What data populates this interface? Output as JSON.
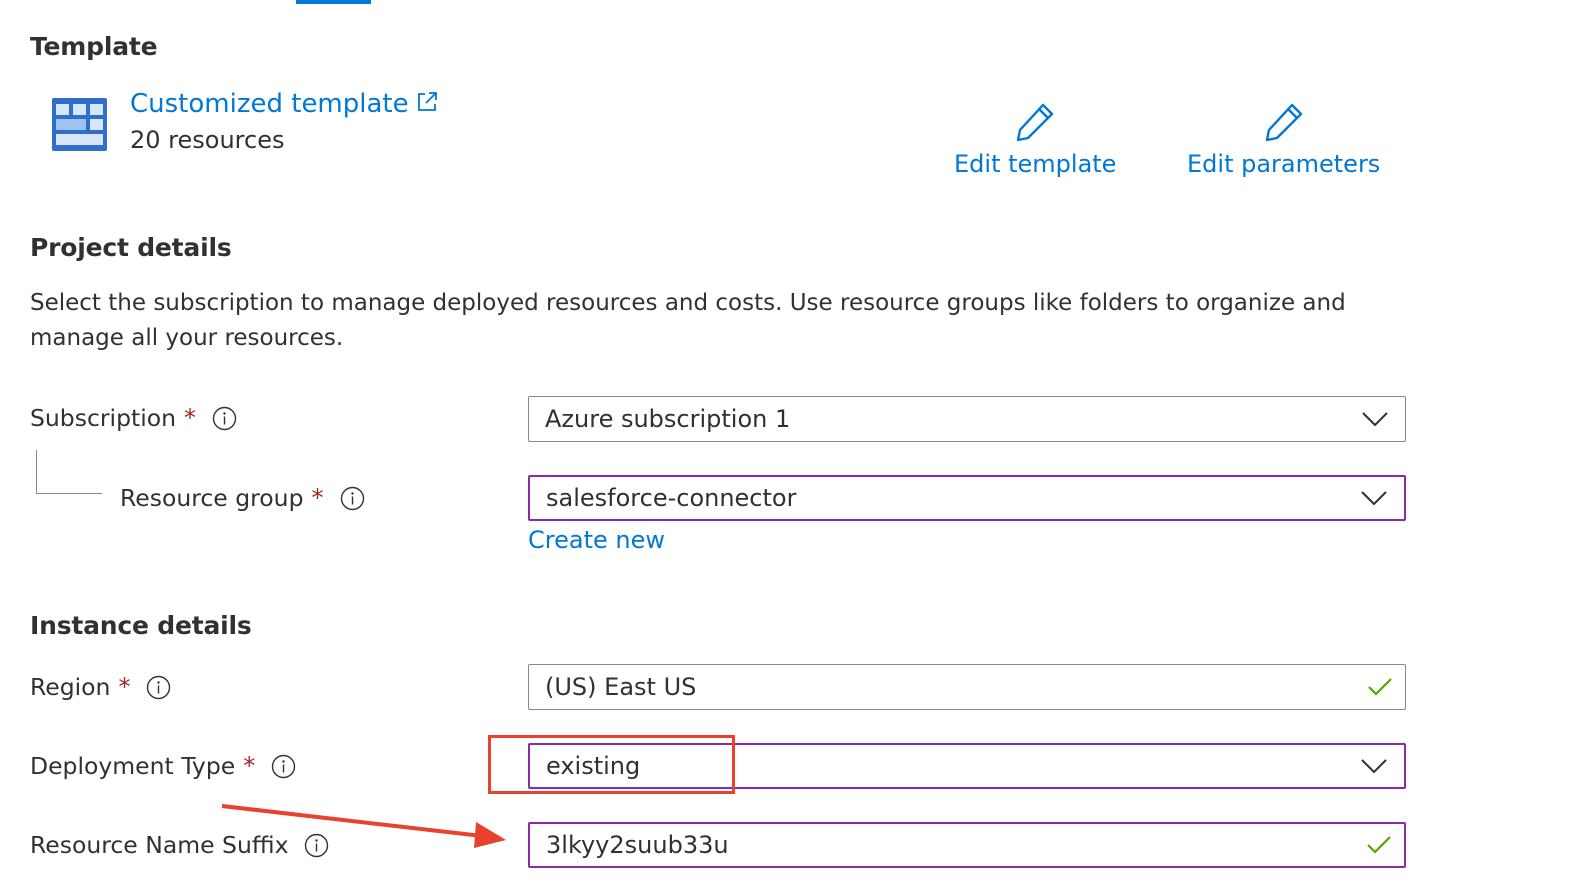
{
  "template_section": {
    "heading": "Template",
    "link_label": "Customized template",
    "resource_count": "20 resources",
    "edit_template_label": "Edit template",
    "edit_parameters_label": "Edit parameters"
  },
  "project_details": {
    "heading": "Project details",
    "description": "Select the subscription to manage deployed resources and costs. Use resource groups like folders to organize and manage all your resources.",
    "subscription": {
      "label": "Subscription",
      "required_mark": "*",
      "value": "Azure subscription 1"
    },
    "resource_group": {
      "label": "Resource group",
      "required_mark": "*",
      "value": "salesforce-connector",
      "create_new_label": "Create new"
    }
  },
  "instance_details": {
    "heading": "Instance details",
    "region": {
      "label": "Region",
      "required_mark": "*",
      "value": "(US) East US"
    },
    "deployment_type": {
      "label": "Deployment Type",
      "required_mark": "*",
      "value": "existing"
    },
    "resource_name_suffix": {
      "label": "Resource Name Suffix",
      "value": "3lkyy2suub33u"
    }
  },
  "colors": {
    "link": "#0078d4",
    "required": "#a4262c",
    "focus_border": "#8a2aa8",
    "valid_check": "#57a300",
    "annotation": "#e8412c"
  }
}
